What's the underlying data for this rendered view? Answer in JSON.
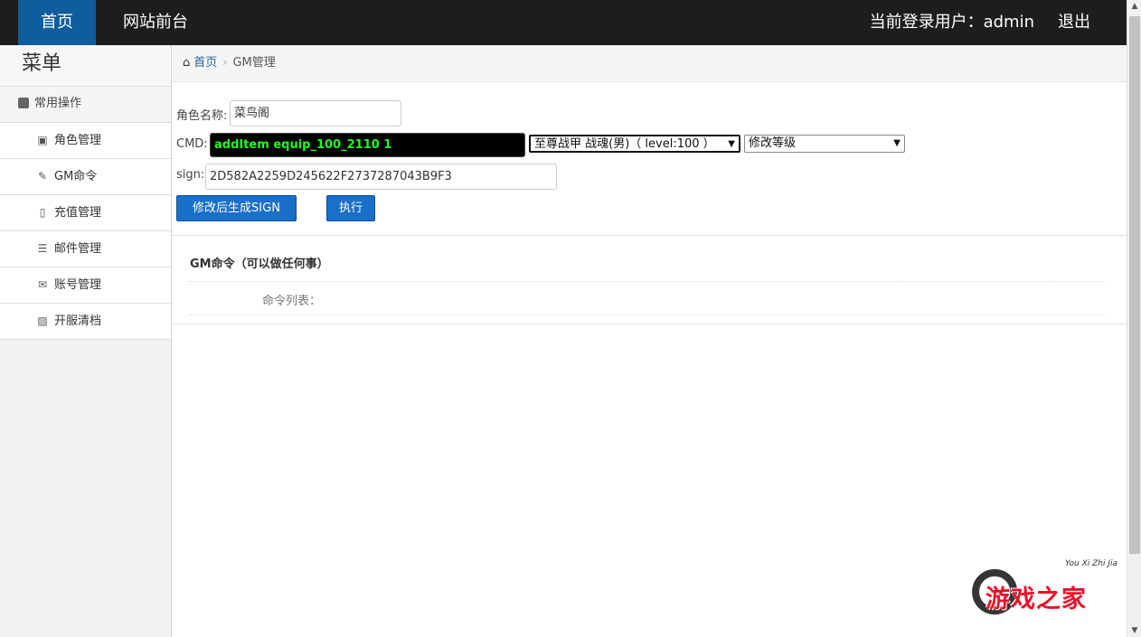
{
  "topbar": {
    "home": "首页",
    "front": "网站前台",
    "user": "当前登录用户：admin",
    "logout": "退出"
  },
  "sidebar": {
    "title": "菜单",
    "group": "常用操作",
    "items": [
      {
        "label": "角色管理",
        "icon": "users-icon"
      },
      {
        "label": "GM命令",
        "icon": "wrench-icon"
      },
      {
        "label": "充值管理",
        "icon": "file-icon"
      },
      {
        "label": "邮件管理",
        "icon": "list-icon"
      },
      {
        "label": "账号管理",
        "icon": "envelope-icon"
      },
      {
        "label": "开服清档",
        "icon": "image-icon"
      }
    ]
  },
  "breadcrumb": {
    "home": "首页",
    "current": "GM管理"
  },
  "form": {
    "role_label": "角色名称:",
    "role_value": "菜鸟阁",
    "cmd_label": "CMD:",
    "cmd_value": "addItem equip_100_2110 1",
    "item_select": "至尊战甲 战魂(男)（ level:100 ）",
    "action_select": "修改等级",
    "sign_label": "sign:",
    "sign_value": "2D582A2259D245622F2737287043B9F3",
    "gen_sign_button": "修改后生成SIGN",
    "execute_button": "执行"
  },
  "gm_section": {
    "title": "GM命令（可以做任何事）",
    "list_label": "命令列表："
  },
  "watermark": {
    "brand": "游戏之家",
    "pinyin": "You Xi Zhi Jia"
  },
  "colors": {
    "topbar_bg": "#1d1d1d",
    "active_nav": "#0f5d9d",
    "button_blue": "#1a6fc9",
    "cmd_text": "#1cff1c",
    "watermark_red": "#e8132a"
  }
}
